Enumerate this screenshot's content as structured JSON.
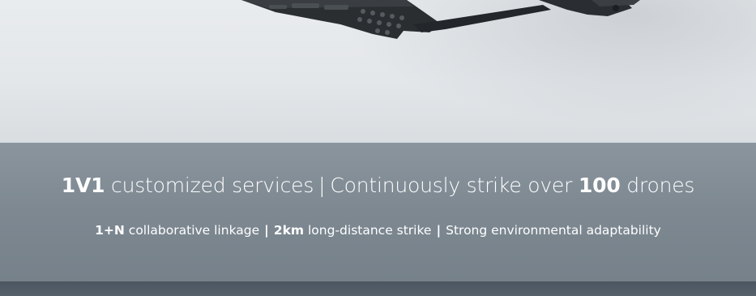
{
  "headline": {
    "part1_bold": "1V1",
    "part1_rest": " customized services",
    "separator": "|",
    "part2_rest": "Continuously strike over ",
    "part2_bold": "100",
    "part2_tail": " drones"
  },
  "features": {
    "f1_bold": "1+N",
    "f1_rest": " collaborative linkage",
    "sep1": "|",
    "f2_bold": "2km",
    "f2_rest": " long-distance strike",
    "sep2": "|",
    "f3": "Strong environmental adaptability"
  },
  "colors": {
    "band": "#7d8891",
    "footer_strip": "#4b5660",
    "hero_background": "#e6e9ec",
    "text": "#ffffff"
  },
  "icons": [
    "device-image"
  ]
}
